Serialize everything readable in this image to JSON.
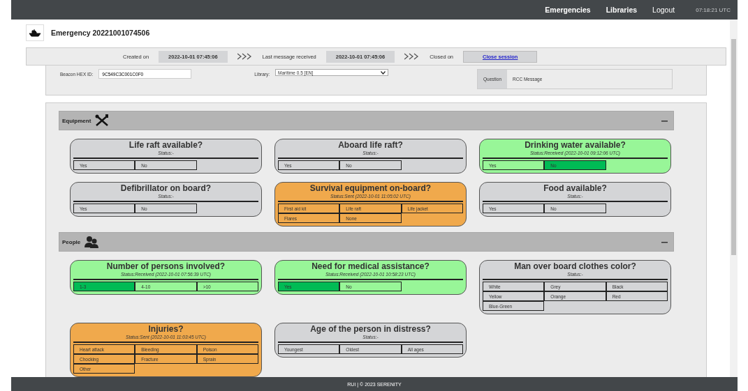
{
  "nav": {
    "links": [
      {
        "label": "Emergencies",
        "bold": true
      },
      {
        "label": "Libraries",
        "bold": true
      },
      {
        "label": "Logout",
        "bold": false
      }
    ],
    "clock": "07:18:21 UTC"
  },
  "header": {
    "title": "Emergency 20221001074506"
  },
  "timeline": {
    "created_label": "Created on",
    "created_value": "2022-10-01 07:45:06",
    "last_label": "Last message received",
    "last_value": "2022-10-01 07:45:06",
    "closed_label": "Closed on",
    "close_link": "Close session"
  },
  "info": {
    "beacon_label": "Beacon HEX ID:",
    "beacon_value": "9C549C3C001C0F0",
    "library_label": "Library:",
    "library_value": "Maritime 0.5 [EN]",
    "question_label": "Question",
    "question_value": "RCC Message"
  },
  "sections": [
    {
      "title": "Equipment",
      "kind": "tools",
      "expanded": true,
      "cards": [
        {
          "title": "Life raft available?",
          "kind": "none",
          "status_text": "Status:-",
          "options": [
            {
              "label": "Yes",
              "selected": false
            },
            {
              "label": "No",
              "selected": false
            }
          ]
        },
        {
          "title": "Aboard life raft?",
          "kind": "none",
          "status_text": "Status:-",
          "options": [
            {
              "label": "Yes",
              "selected": false
            },
            {
              "label": "No",
              "selected": false
            }
          ]
        },
        {
          "title": "Drinking water available?",
          "kind": "received",
          "status_text": "Status:Received (2022-10-01 09:12:06 UTC)",
          "options": [
            {
              "label": "Yes",
              "selected": false
            },
            {
              "label": "No",
              "selected": true
            }
          ]
        },
        {
          "title": "Defibrillator on board?",
          "kind": "none",
          "status_text": "Status:-",
          "options": [
            {
              "label": "Yes",
              "selected": false
            },
            {
              "label": "No",
              "selected": false
            }
          ]
        },
        {
          "title": "Survival equipment on-board?",
          "kind": "sent",
          "status_text": "Status:Sent (2022-10-01 11:05:02 UTC)",
          "options": [
            {
              "label": "First aid kit",
              "selected": false
            },
            {
              "label": "Life raft",
              "selected": false
            },
            {
              "label": "Life jacket",
              "selected": false
            },
            {
              "label": "Flares",
              "selected": false
            },
            {
              "label": "None",
              "selected": false
            }
          ]
        },
        {
          "title": "Food available?",
          "kind": "none",
          "status_text": "Status:-",
          "options": [
            {
              "label": "Yes",
              "selected": false
            },
            {
              "label": "No",
              "selected": false
            }
          ]
        }
      ]
    },
    {
      "title": "People",
      "kind": "people",
      "expanded": true,
      "cards": [
        {
          "title": "Number of persons involved?",
          "kind": "received",
          "status_text": "Status:Received (2022-10-01 07:56:39 UTC)",
          "options": [
            {
              "label": "1-3",
              "selected": true
            },
            {
              "label": "4-10",
              "selected": false
            },
            {
              "label": ">10",
              "selected": false
            }
          ]
        },
        {
          "title": "Need for medical assistance?",
          "kind": "received",
          "status_text": "Status:Received (2022-10-01 10:58:23 UTC)",
          "options": [
            {
              "label": "Yes",
              "selected": true
            },
            {
              "label": "No",
              "selected": false
            }
          ]
        },
        {
          "title": "Man over board clothes color?",
          "kind": "none",
          "status_text": "Status:-",
          "options": [
            {
              "label": "White",
              "selected": false
            },
            {
              "label": "Grey",
              "selected": false
            },
            {
              "label": "Black",
              "selected": false
            },
            {
              "label": "Yellow",
              "selected": false
            },
            {
              "label": "Orange",
              "selected": false
            },
            {
              "label": "Red",
              "selected": false
            },
            {
              "label": "Blue-Green",
              "selected": false
            }
          ]
        },
        {
          "title": "Injuries?",
          "kind": "sent",
          "status_text": "Status:Sent (2022-10-01 11:03:45 UTC)",
          "options": [
            {
              "label": "Heart attack",
              "selected": false
            },
            {
              "label": "Bleeding",
              "selected": false
            },
            {
              "label": "Poison",
              "selected": false
            },
            {
              "label": "Chocking",
              "selected": false
            },
            {
              "label": "Fracture",
              "selected": false
            },
            {
              "label": "Sprain",
              "selected": false
            },
            {
              "label": "Other",
              "selected": false
            }
          ]
        },
        {
          "title": "Age of the person in distress?",
          "kind": "none",
          "status_text": "Status:-",
          "options": [
            {
              "label": "Youngest",
              "selected": false
            },
            {
              "label": "Oldest",
              "selected": false
            },
            {
              "label": "All ages",
              "selected": false
            }
          ]
        }
      ]
    }
  ],
  "footer": {
    "text": "RUI | © 2023 SERENITY"
  }
}
